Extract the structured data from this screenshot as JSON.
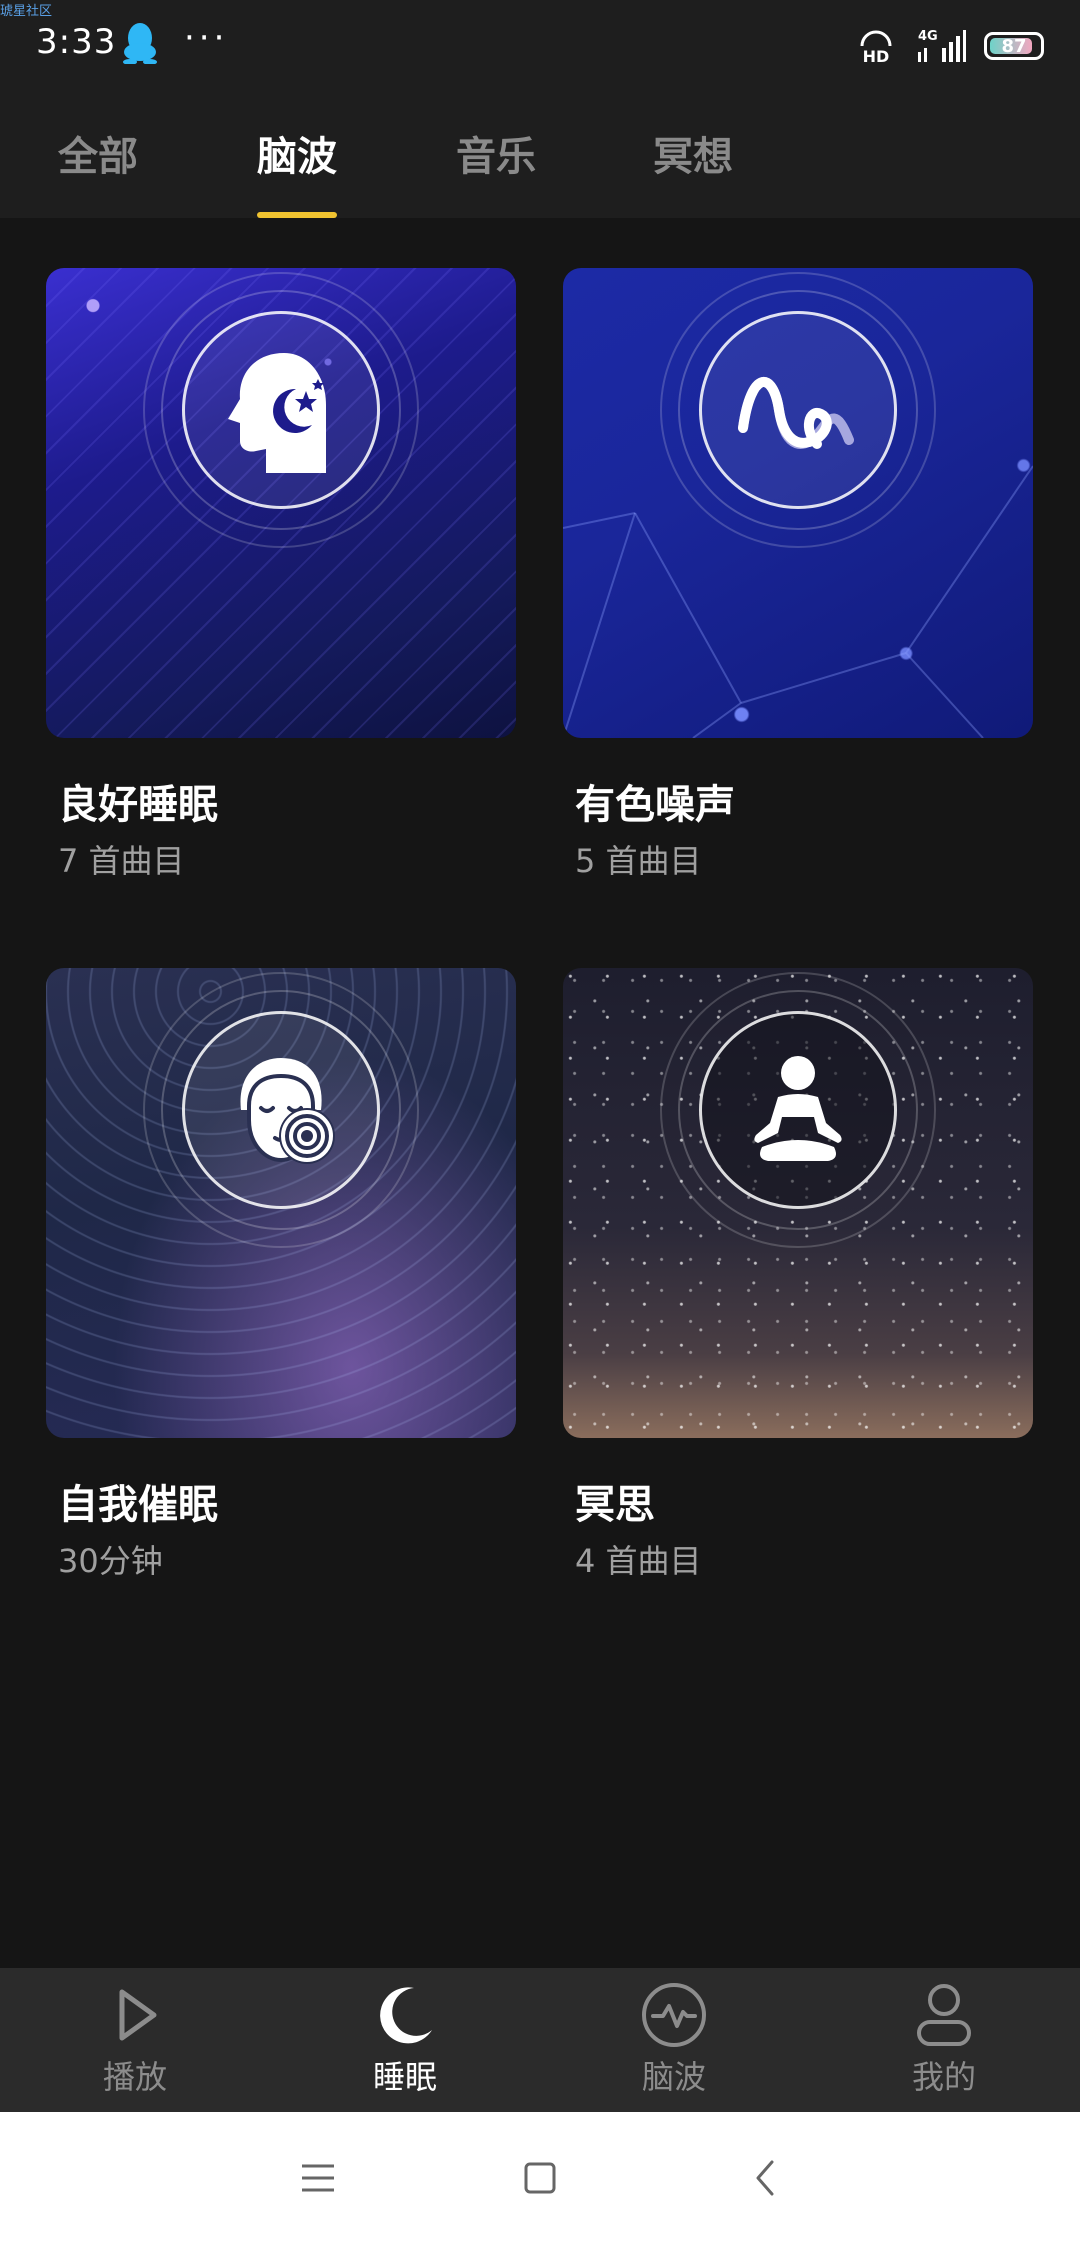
{
  "status_bar": {
    "watermark": "琥星社区",
    "time": "3:33",
    "more": "···",
    "network": "4G",
    "battery": "87",
    "battery_level": 0.87,
    "hd": "HD"
  },
  "tabs": [
    {
      "label": "全部",
      "active": false
    },
    {
      "label": "脑波",
      "active": true
    },
    {
      "label": "音乐",
      "active": false
    },
    {
      "label": "冥想",
      "active": false
    }
  ],
  "cards": [
    {
      "title": "良好睡眠",
      "subtitle": "7 首曲目",
      "icon": "sleeping-head-icon"
    },
    {
      "title": "有色噪声",
      "subtitle": "5 首曲目",
      "icon": "sound-wave-icon"
    },
    {
      "title": "自我催眠",
      "subtitle": "30分钟",
      "icon": "hypnosis-face-icon"
    },
    {
      "title": "冥思",
      "subtitle": "4 首曲目",
      "icon": "meditation-icon"
    }
  ],
  "bottom_nav": [
    {
      "label": "播放",
      "icon": "play-icon",
      "active": false
    },
    {
      "label": "睡眠",
      "icon": "moon-icon",
      "active": true
    },
    {
      "label": "脑波",
      "icon": "brainwave-icon",
      "active": false
    },
    {
      "label": "我的",
      "icon": "profile-icon",
      "active": false
    }
  ],
  "system_nav": [
    "menu-icon",
    "home-icon",
    "back-icon"
  ],
  "colors": {
    "accent": "#f0c330",
    "background": "#151515",
    "bar": "#1e1e1e",
    "nav": "#2b2b2b"
  }
}
